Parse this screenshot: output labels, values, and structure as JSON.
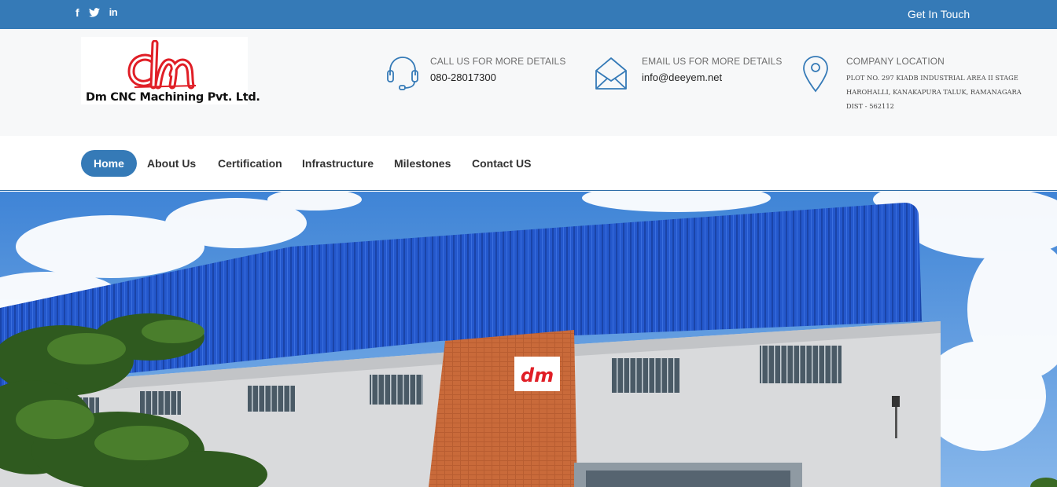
{
  "topbar": {
    "social": [
      {
        "icon": "facebook-icon",
        "glyph": "f"
      },
      {
        "icon": "twitter-icon",
        "glyph": ""
      },
      {
        "icon": "linkedin-icon",
        "glyph": "in"
      }
    ],
    "cta_label": "Get In Touch",
    "bg_color": "#357ab7"
  },
  "logo": {
    "monogram": "dm",
    "company_name": "Dm CNC Machining Pvt. Ltd.",
    "brand_color": "#e01e26"
  },
  "contacts": {
    "phone": {
      "icon": "headset-icon",
      "label": "CALL US FOR MORE DETAILS",
      "value": "080-28017300"
    },
    "email": {
      "icon": "envelope-icon",
      "label": "EMAIL US FOR MORE DETAILS",
      "value": "info@deeyem.net"
    },
    "location": {
      "icon": "map-pin-icon",
      "label": "COMPANY LOCATION",
      "lines": [
        "PLOT NO. 297 KIADB INDUSTRIAL AREA II STAGE",
        "HAROHALLI, KANAKAPURA TALUK, RAMANAGARA",
        "DIST - 562112"
      ]
    }
  },
  "nav": {
    "items": [
      {
        "label": "Home",
        "active": true
      },
      {
        "label": "About Us",
        "active": false
      },
      {
        "label": "Certification",
        "active": false
      },
      {
        "label": "Infrastructure",
        "active": false
      },
      {
        "label": "Milestones",
        "active": false
      },
      {
        "label": "Contact US",
        "active": false
      }
    ],
    "accent_color": "#357ab7"
  },
  "hero": {
    "sign_text": "dm",
    "sky_color": "#4f8fd8",
    "roof_color": "#2255c8"
  }
}
